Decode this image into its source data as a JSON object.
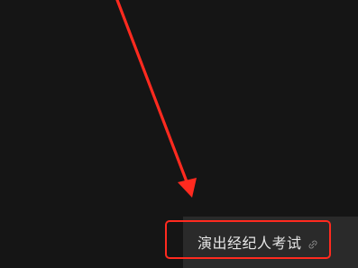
{
  "chip": {
    "label": "演出经纪人考试",
    "icon": "link-icon"
  },
  "colors": {
    "background": "#151515",
    "panel": "#2a2a2a",
    "text": "#e6e6e6",
    "annotation": "#ff2a1f"
  }
}
